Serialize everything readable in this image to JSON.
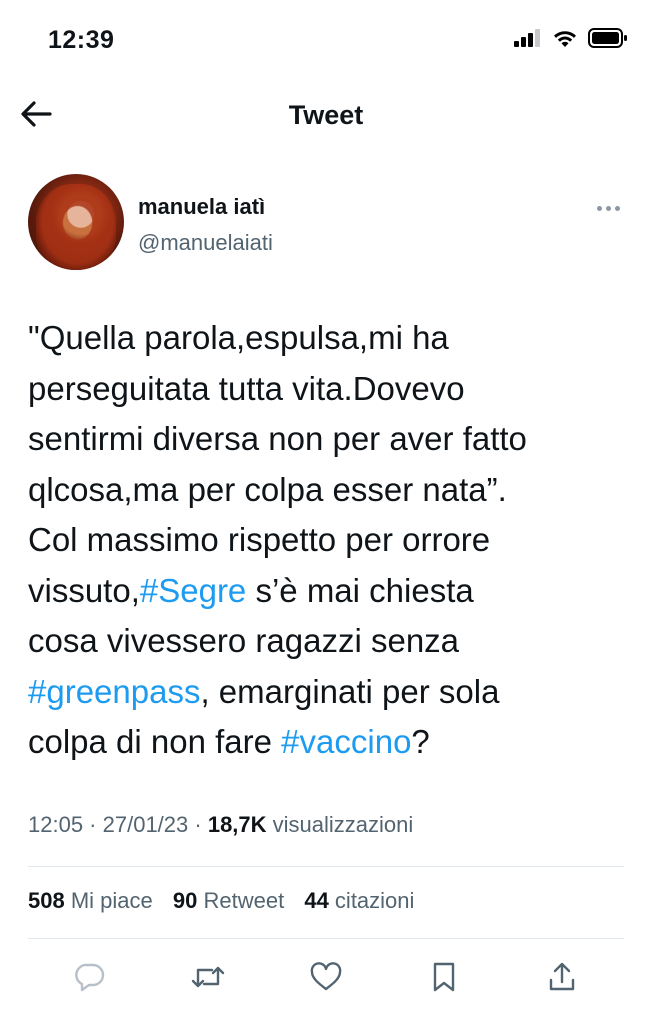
{
  "status_bar": {
    "time": "12:39"
  },
  "nav": {
    "title": "Tweet"
  },
  "author": {
    "name": "manuela iatì",
    "handle": "@manuelaiati"
  },
  "tweet": {
    "lines": [
      [
        {
          "t": "\"Quella parola,espulsa,mi ha"
        }
      ],
      [
        {
          "t": "perseguitata tutta vita.Dovevo"
        }
      ],
      [
        {
          "t": "sentirmi diversa non per aver fatto"
        }
      ],
      [
        {
          "t": "qlcosa,ma per colpa esser nata”."
        }
      ],
      [
        {
          "t": "Col massimo rispetto per orrore"
        }
      ],
      [
        {
          "t": "vissuto,"
        },
        {
          "t": "#Segre",
          "tag": true
        },
        {
          "t": " s’è mai chiesta"
        }
      ],
      [
        {
          "t": "cosa vivessero ragazzi senza"
        }
      ],
      [
        {
          "t": "#greenpass",
          "tag": true
        },
        {
          "t": ", emarginati per sola"
        }
      ],
      [
        {
          "t": "colpa di non fare "
        },
        {
          "t": "#vaccino",
          "tag": true
        },
        {
          "t": "?"
        }
      ]
    ]
  },
  "meta": {
    "time": "12:05",
    "sep1": " · ",
    "date": "27/01/23",
    "sep2": " · ",
    "views": "18,7K",
    "views_label": " visualizzazioni"
  },
  "stats": {
    "likes": "508",
    "likes_label": " Mi piace",
    "retweets": "90",
    "retweets_label": " Retweet",
    "quotes": "44",
    "quotes_label": " citazioni"
  },
  "colors": {
    "accent": "#1d9bf0",
    "text": "#0f1419",
    "secondary": "#536471",
    "divider": "#e1e8ed"
  },
  "icons": [
    "back-arrow-icon",
    "more-icon",
    "reply-icon",
    "retweet-icon",
    "like-icon",
    "bookmark-icon",
    "share-icon",
    "signal-icon",
    "wifi-icon",
    "battery-icon"
  ]
}
